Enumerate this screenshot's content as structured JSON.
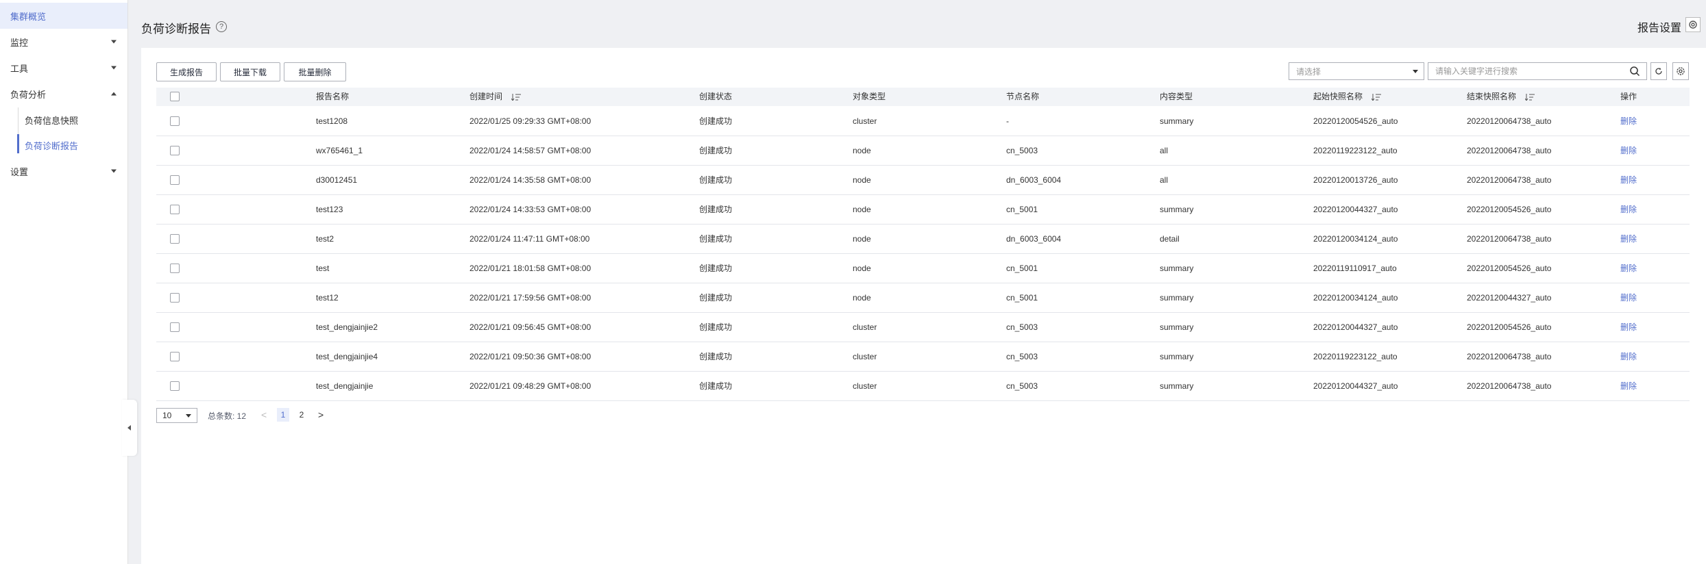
{
  "sidebar": {
    "items": [
      {
        "label": "集群概览"
      },
      {
        "label": "监控"
      },
      {
        "label": "工具"
      },
      {
        "label": "负荷分析"
      },
      {
        "label": "设置"
      }
    ],
    "subitems": [
      {
        "label": "负荷信息快照"
      },
      {
        "label": "负荷诊断报告"
      }
    ]
  },
  "header": {
    "title": "负荷诊断报告",
    "help_icon": "?",
    "settings_label": "报告设置"
  },
  "toolbar": {
    "generate_label": "生成报告",
    "download_label": "批量下载",
    "delete_label": "批量删除",
    "select_placeholder": "请选择",
    "search_placeholder": "请输入关键字进行搜索"
  },
  "table": {
    "columns": [
      "报告名称",
      "创建时间",
      "创建状态",
      "对象类型",
      "节点名称",
      "内容类型",
      "起始快照名称",
      "结束快照名称",
      "操作"
    ],
    "rows": [
      [
        "test1208",
        "2022/01/25 09:29:33 GMT+08:00",
        "创建成功",
        "cluster",
        "-",
        "summary",
        "20220120054526_auto",
        "20220120064738_auto",
        "删除"
      ],
      [
        "wx765461_1",
        "2022/01/24 14:58:57 GMT+08:00",
        "创建成功",
        "node",
        "cn_5003",
        "all",
        "20220119223122_auto",
        "20220120064738_auto",
        "删除"
      ],
      [
        "d30012451",
        "2022/01/24 14:35:58 GMT+08:00",
        "创建成功",
        "node",
        "dn_6003_6004",
        "all",
        "20220120013726_auto",
        "20220120064738_auto",
        "删除"
      ],
      [
        "test123",
        "2022/01/24 14:33:53 GMT+08:00",
        "创建成功",
        "node",
        "cn_5001",
        "summary",
        "20220120044327_auto",
        "20220120054526_auto",
        "删除"
      ],
      [
        "test2",
        "2022/01/24 11:47:11 GMT+08:00",
        "创建成功",
        "node",
        "dn_6003_6004",
        "detail",
        "20220120034124_auto",
        "20220120064738_auto",
        "删除"
      ],
      [
        "test",
        "2022/01/21 18:01:58 GMT+08:00",
        "创建成功",
        "node",
        "cn_5001",
        "summary",
        "20220119110917_auto",
        "20220120054526_auto",
        "删除"
      ],
      [
        "test12",
        "2022/01/21 17:59:56 GMT+08:00",
        "创建成功",
        "node",
        "cn_5001",
        "summary",
        "20220120034124_auto",
        "20220120044327_auto",
        "删除"
      ],
      [
        "test_dengjainjie2",
        "2022/01/21 09:56:45 GMT+08:00",
        "创建成功",
        "cluster",
        "cn_5003",
        "summary",
        "20220120044327_auto",
        "20220120054526_auto",
        "删除"
      ],
      [
        "test_dengjainjie4",
        "2022/01/21 09:50:36 GMT+08:00",
        "创建成功",
        "cluster",
        "cn_5003",
        "summary",
        "20220119223122_auto",
        "20220120064738_auto",
        "删除"
      ],
      [
        "test_dengjainjie",
        "2022/01/21 09:48:29 GMT+08:00",
        "创建成功",
        "cluster",
        "cn_5003",
        "summary",
        "20220120044327_auto",
        "20220120064738_auto",
        "删除"
      ]
    ]
  },
  "pagination": {
    "page_size": "10",
    "total_label": "总条数: 12",
    "prev": "<",
    "next": ">",
    "pages": [
      "1",
      "2"
    ]
  },
  "colors": {
    "accent": "#526ecc",
    "page_bg": "#eff0f3",
    "header_row_bg": "#f2f4f7"
  }
}
